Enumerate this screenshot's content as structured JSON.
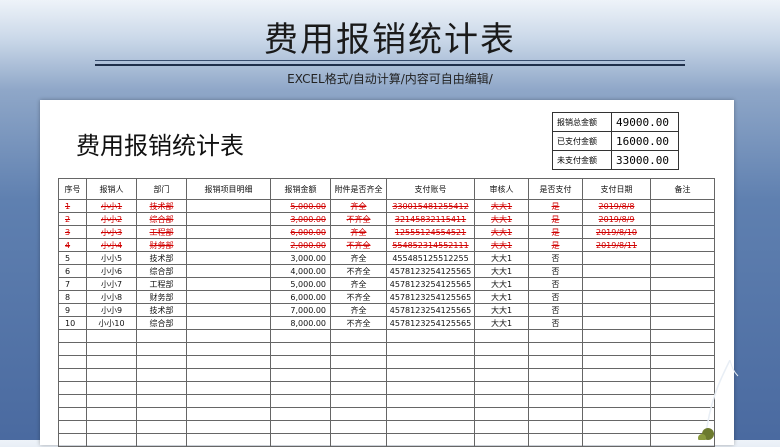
{
  "banner": {
    "title": "费用报销统计表",
    "subtitle": "EXCEL格式/自动计算/内容可自由编辑/"
  },
  "doc": {
    "title": "费用报销统计表"
  },
  "summary": [
    {
      "label": "报销总金额",
      "value": "49000.00"
    },
    {
      "label": "已支付金额",
      "value": "16000.00"
    },
    {
      "label": "未支付金额",
      "value": "33000.00"
    }
  ],
  "table": {
    "headers": [
      "序号",
      "报销人",
      "部门",
      "报销项目明细",
      "报销金额",
      "附件是否齐全",
      "支付账号",
      "审核人",
      "是否支付",
      "支付日期",
      "备注"
    ],
    "rows": [
      {
        "no": "1",
        "person": "小小1",
        "dept": "技术部",
        "detail": "",
        "amount": "5,000.00",
        "attach": "齐全",
        "account": "330015481255412",
        "auditor": "大大1",
        "paid": "是",
        "date": "2019/8/8",
        "note": "",
        "strike": true
      },
      {
        "no": "2",
        "person": "小小2",
        "dept": "综合部",
        "detail": "",
        "amount": "3,000.00",
        "attach": "不齐全",
        "account": "32145832115411",
        "auditor": "大大1",
        "paid": "是",
        "date": "2019/8/9",
        "note": "",
        "strike": true
      },
      {
        "no": "3",
        "person": "小小3",
        "dept": "工程部",
        "detail": "",
        "amount": "6,000.00",
        "attach": "齐全",
        "account": "12555124554521",
        "auditor": "大大1",
        "paid": "是",
        "date": "2019/8/10",
        "note": "",
        "strike": true
      },
      {
        "no": "4",
        "person": "小小4",
        "dept": "财务部",
        "detail": "",
        "amount": "2,000.00",
        "attach": "不齐全",
        "account": "554852314552111",
        "auditor": "大大1",
        "paid": "是",
        "date": "2019/8/11",
        "note": "",
        "strike": true
      },
      {
        "no": "5",
        "person": "小小5",
        "dept": "技术部",
        "detail": "",
        "amount": "3,000.00",
        "attach": "齐全",
        "account": "455485125512255",
        "auditor": "大大1",
        "paid": "否",
        "date": "",
        "note": "",
        "strike": false
      },
      {
        "no": "6",
        "person": "小小6",
        "dept": "综合部",
        "detail": "",
        "amount": "4,000.00",
        "attach": "不齐全",
        "account": "4578123254125565",
        "auditor": "大大1",
        "paid": "否",
        "date": "",
        "note": "",
        "strike": false
      },
      {
        "no": "7",
        "person": "小小7",
        "dept": "工程部",
        "detail": "",
        "amount": "5,000.00",
        "attach": "齐全",
        "account": "4578123254125565",
        "auditor": "大大1",
        "paid": "否",
        "date": "",
        "note": "",
        "strike": false
      },
      {
        "no": "8",
        "person": "小小8",
        "dept": "财务部",
        "detail": "",
        "amount": "6,000.00",
        "attach": "不齐全",
        "account": "4578123254125565",
        "auditor": "大大1",
        "paid": "否",
        "date": "",
        "note": "",
        "strike": false
      },
      {
        "no": "9",
        "person": "小小9",
        "dept": "技术部",
        "detail": "",
        "amount": "7,000.00",
        "attach": "齐全",
        "account": "4578123254125565",
        "auditor": "大大1",
        "paid": "否",
        "date": "",
        "note": "",
        "strike": false
      },
      {
        "no": "10",
        "person": "小小10",
        "dept": "综合部",
        "detail": "",
        "amount": "8,000.00",
        "attach": "不齐全",
        "account": "4578123254125565",
        "auditor": "大大1",
        "paid": "否",
        "date": "",
        "note": "",
        "strike": false
      }
    ],
    "empty_rows": 9
  },
  "colors": {
    "strike_text": "#d00000",
    "banner_bg": "#5f80b0"
  }
}
